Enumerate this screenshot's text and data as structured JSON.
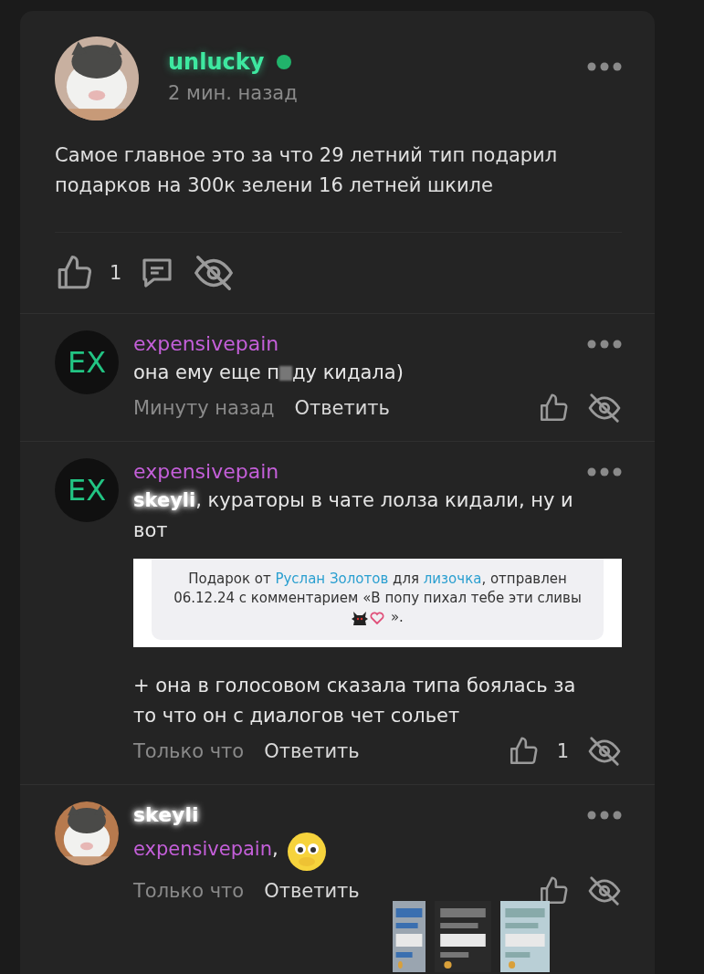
{
  "post": {
    "author": "unlucky",
    "online": true,
    "time": "2 мин. назад",
    "text": "Самое главное это за что 29 летний тип подарил подарков на 300к зелени 16 летней шкиле",
    "likes": "1"
  },
  "comments": [
    {
      "author": "expensivepain",
      "kind": "mention",
      "avatar": {
        "kind": "initials",
        "text": "EX"
      },
      "body": [
        {
          "kind": "text",
          "parts": [
            {
              "kind": "plain",
              "text": "она ему еще п"
            },
            {
              "kind": "censor"
            },
            {
              "kind": "plain",
              "text": "ду кидала)"
            }
          ]
        }
      ],
      "time": "Минуту назад",
      "reply": "Ответить"
    },
    {
      "author": "expensivepain",
      "kind": "mention",
      "avatar": {
        "kind": "initials",
        "text": "EX"
      },
      "body": [
        {
          "kind": "text",
          "parts": [
            {
              "kind": "mention-blur",
              "text": "skeyli"
            },
            {
              "kind": "plain",
              "text": ", кураторы в чате лолза кидали, ну и вот"
            }
          ]
        },
        {
          "kind": "gift",
          "parts": [
            {
              "kind": "plain",
              "text": "Подарок от "
            },
            {
              "kind": "link",
              "text": "Руслан Золотов"
            },
            {
              "kind": "plain",
              "text": " для "
            },
            {
              "kind": "link",
              "text": "лизочка"
            },
            {
              "kind": "plain",
              "text": ", отправлен 06.12.24 с комментарием «В попу пихал тебе эти сливы "
            },
            {
              "kind": "devil"
            },
            {
              "kind": "heart"
            },
            {
              "kind": "plain",
              "text": " »."
            }
          ]
        },
        {
          "kind": "text",
          "parts": [
            {
              "kind": "plain",
              "text": "+ она в голосовом сказала типа боялась за то что он с диалогов чет сольет"
            }
          ]
        }
      ],
      "time": "Только что",
      "reply": "Ответить",
      "likes": "1"
    },
    {
      "author": "skeyli",
      "kind": "blurred",
      "avatar": {
        "kind": "picture"
      },
      "body": [
        {
          "kind": "text",
          "parts": [
            {
              "kind": "mention",
              "text": "expensivepain"
            },
            {
              "kind": "plain",
              "text": ", "
            },
            {
              "kind": "emoji"
            }
          ]
        }
      ],
      "time": "Только что",
      "reply": "Ответить"
    }
  ]
}
